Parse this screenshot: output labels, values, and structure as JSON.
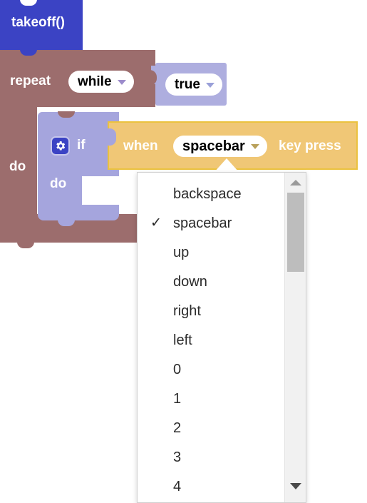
{
  "workspace": {
    "blocks": {
      "takeoff": {
        "label": "takeoff()",
        "color": "#3b43c4"
      },
      "repeat": {
        "label": "repeat",
        "do_label": "do",
        "mode_value": "while",
        "color": "#9c6d6d"
      },
      "condition": {
        "value": "true",
        "color": "#aeaedf"
      },
      "if": {
        "label": "if",
        "do_label": "do",
        "gear_icon": "gear-icon",
        "color": "#a5a5dd"
      },
      "when_key_press": {
        "prefix_label": "when",
        "suffix_label": "key press",
        "selected_key": "spacebar",
        "color": "#f0c776",
        "border_color": "#ebc23f"
      }
    }
  },
  "dropdown": {
    "selected": "spacebar",
    "check_glyph": "✓",
    "items": [
      {
        "label": "backspace",
        "selected": false
      },
      {
        "label": "spacebar",
        "selected": true
      },
      {
        "label": "up",
        "selected": false
      },
      {
        "label": "down",
        "selected": false
      },
      {
        "label": "right",
        "selected": false
      },
      {
        "label": "left",
        "selected": false
      },
      {
        "label": "0",
        "selected": false
      },
      {
        "label": "1",
        "selected": false
      },
      {
        "label": "2",
        "selected": false
      },
      {
        "label": "3",
        "selected": false
      },
      {
        "label": "4",
        "selected": false
      }
    ],
    "scrollbar": {
      "up_arrow_icon": "scroll-up-arrow-icon",
      "down_arrow_icon": "scroll-down-arrow-icon"
    }
  }
}
